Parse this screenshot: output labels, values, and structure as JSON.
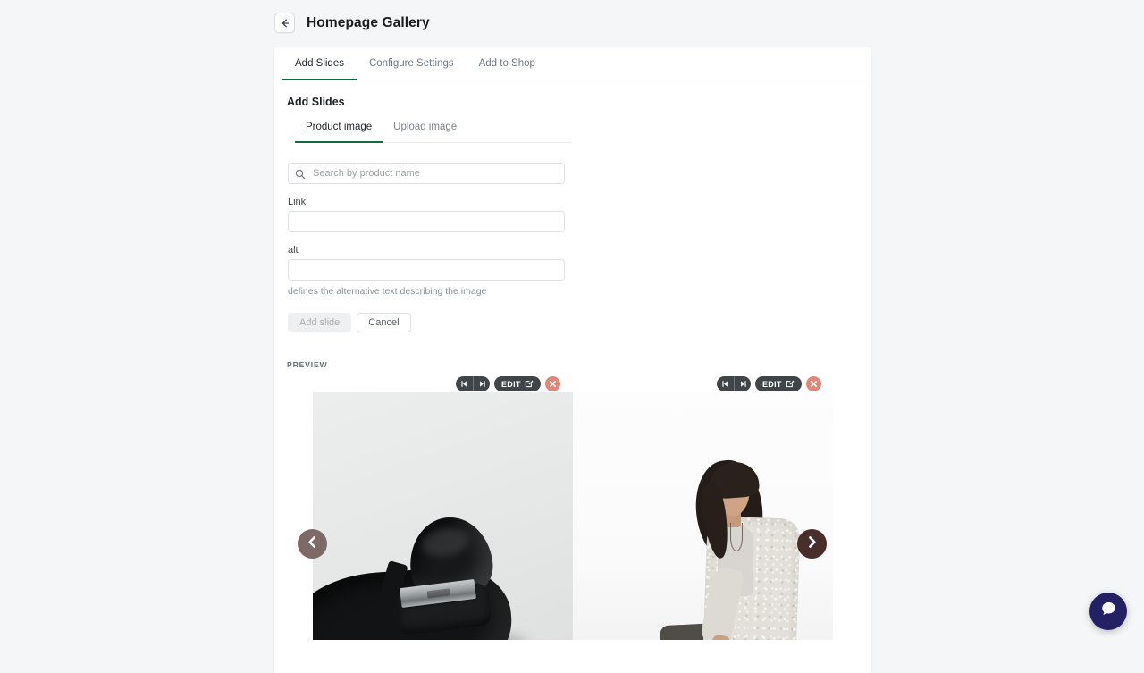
{
  "header": {
    "back_icon": "arrow-left-icon",
    "title": "Homepage Gallery"
  },
  "tabs": [
    {
      "label": "Add Slides",
      "active": true
    },
    {
      "label": "Configure Settings",
      "active": false
    },
    {
      "label": "Add to Shop",
      "active": false
    }
  ],
  "section": {
    "title": "Add Slides"
  },
  "subtabs": [
    {
      "label": "Product image",
      "active": true
    },
    {
      "label": "Upload image",
      "active": false
    }
  ],
  "search": {
    "icon": "search-icon",
    "placeholder": "Search by product name",
    "value": ""
  },
  "fields": [
    {
      "label": "Link",
      "value": "",
      "placeholder": ""
    },
    {
      "label": "alt",
      "value": "",
      "placeholder": ""
    }
  ],
  "help_text": "defines the alternative text describing the image",
  "actions": {
    "submit_label": "Add slide",
    "cancel_label": "Cancel"
  },
  "preview": {
    "label": "PREVIEW",
    "slides": [
      {
        "alt": "Black leather dress shoe with silver metal plate",
        "toolbar": {
          "move_left_icon": "move-left-icon",
          "move_right_icon": "move-right-icon",
          "edit_label": "EDIT",
          "edit_icon": "pencil-square-icon",
          "delete_icon": "close-circle-icon"
        }
      },
      {
        "alt": "Woman seated wearing light knit cardigan",
        "toolbar": {
          "move_left_icon": "move-left-icon",
          "move_right_icon": "move-right-icon",
          "edit_label": "EDIT",
          "edit_icon": "pencil-square-icon",
          "delete_icon": "close-circle-icon"
        }
      }
    ],
    "carousel": {
      "prev_icon": "chevron-left-icon",
      "next_icon": "chevron-right-icon"
    }
  },
  "chat": {
    "icon": "chat-bubble-icon"
  },
  "colors": {
    "accent_green": "#0f6b42",
    "toolbar_dark": "#3f4548",
    "delete_red": "#e08877",
    "arrow_prev": "#7d6a68",
    "arrow_next": "#4a2e2c",
    "chat_navy": "#232063",
    "page_bg": "#f5f6f7"
  }
}
